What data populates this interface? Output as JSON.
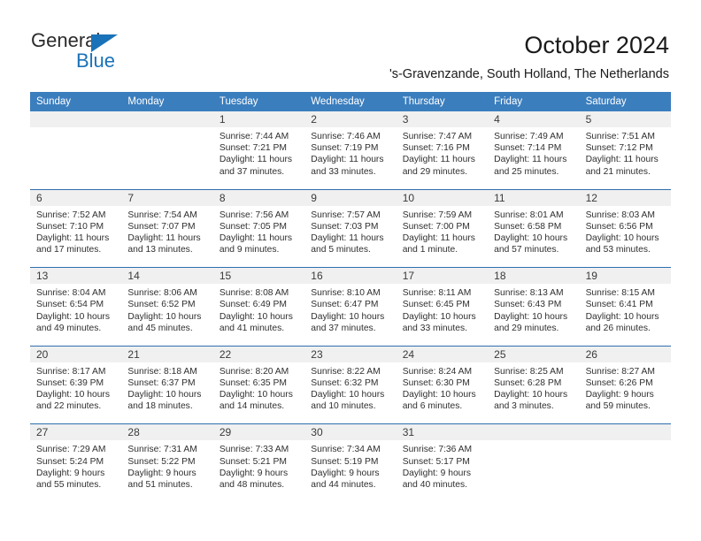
{
  "brand": {
    "name_part1": "General",
    "name_part2": "Blue",
    "accent_color": "#1a72b8"
  },
  "header": {
    "title": "October 2024",
    "subtitle": "'s-Gravenzande, South Holland, The Netherlands"
  },
  "theme": {
    "header_blue": "#3b7ebe",
    "row_divider_blue": "#2f6fae",
    "day_band_gray": "#f0f0f0"
  },
  "weekdays": [
    "Sunday",
    "Monday",
    "Tuesday",
    "Wednesday",
    "Thursday",
    "Friday",
    "Saturday"
  ],
  "weeks": [
    [
      {
        "day": "",
        "sunrise": "",
        "sunset": "",
        "daylight": ""
      },
      {
        "day": "",
        "sunrise": "",
        "sunset": "",
        "daylight": ""
      },
      {
        "day": "1",
        "sunrise": "Sunrise: 7:44 AM",
        "sunset": "Sunset: 7:21 PM",
        "daylight": "Daylight: 11 hours and 37 minutes."
      },
      {
        "day": "2",
        "sunrise": "Sunrise: 7:46 AM",
        "sunset": "Sunset: 7:19 PM",
        "daylight": "Daylight: 11 hours and 33 minutes."
      },
      {
        "day": "3",
        "sunrise": "Sunrise: 7:47 AM",
        "sunset": "Sunset: 7:16 PM",
        "daylight": "Daylight: 11 hours and 29 minutes."
      },
      {
        "day": "4",
        "sunrise": "Sunrise: 7:49 AM",
        "sunset": "Sunset: 7:14 PM",
        "daylight": "Daylight: 11 hours and 25 minutes."
      },
      {
        "day": "5",
        "sunrise": "Sunrise: 7:51 AM",
        "sunset": "Sunset: 7:12 PM",
        "daylight": "Daylight: 11 hours and 21 minutes."
      }
    ],
    [
      {
        "day": "6",
        "sunrise": "Sunrise: 7:52 AM",
        "sunset": "Sunset: 7:10 PM",
        "daylight": "Daylight: 11 hours and 17 minutes."
      },
      {
        "day": "7",
        "sunrise": "Sunrise: 7:54 AM",
        "sunset": "Sunset: 7:07 PM",
        "daylight": "Daylight: 11 hours and 13 minutes."
      },
      {
        "day": "8",
        "sunrise": "Sunrise: 7:56 AM",
        "sunset": "Sunset: 7:05 PM",
        "daylight": "Daylight: 11 hours and 9 minutes."
      },
      {
        "day": "9",
        "sunrise": "Sunrise: 7:57 AM",
        "sunset": "Sunset: 7:03 PM",
        "daylight": "Daylight: 11 hours and 5 minutes."
      },
      {
        "day": "10",
        "sunrise": "Sunrise: 7:59 AM",
        "sunset": "Sunset: 7:00 PM",
        "daylight": "Daylight: 11 hours and 1 minute."
      },
      {
        "day": "11",
        "sunrise": "Sunrise: 8:01 AM",
        "sunset": "Sunset: 6:58 PM",
        "daylight": "Daylight: 10 hours and 57 minutes."
      },
      {
        "day": "12",
        "sunrise": "Sunrise: 8:03 AM",
        "sunset": "Sunset: 6:56 PM",
        "daylight": "Daylight: 10 hours and 53 minutes."
      }
    ],
    [
      {
        "day": "13",
        "sunrise": "Sunrise: 8:04 AM",
        "sunset": "Sunset: 6:54 PM",
        "daylight": "Daylight: 10 hours and 49 minutes."
      },
      {
        "day": "14",
        "sunrise": "Sunrise: 8:06 AM",
        "sunset": "Sunset: 6:52 PM",
        "daylight": "Daylight: 10 hours and 45 minutes."
      },
      {
        "day": "15",
        "sunrise": "Sunrise: 8:08 AM",
        "sunset": "Sunset: 6:49 PM",
        "daylight": "Daylight: 10 hours and 41 minutes."
      },
      {
        "day": "16",
        "sunrise": "Sunrise: 8:10 AM",
        "sunset": "Sunset: 6:47 PM",
        "daylight": "Daylight: 10 hours and 37 minutes."
      },
      {
        "day": "17",
        "sunrise": "Sunrise: 8:11 AM",
        "sunset": "Sunset: 6:45 PM",
        "daylight": "Daylight: 10 hours and 33 minutes."
      },
      {
        "day": "18",
        "sunrise": "Sunrise: 8:13 AM",
        "sunset": "Sunset: 6:43 PM",
        "daylight": "Daylight: 10 hours and 29 minutes."
      },
      {
        "day": "19",
        "sunrise": "Sunrise: 8:15 AM",
        "sunset": "Sunset: 6:41 PM",
        "daylight": "Daylight: 10 hours and 26 minutes."
      }
    ],
    [
      {
        "day": "20",
        "sunrise": "Sunrise: 8:17 AM",
        "sunset": "Sunset: 6:39 PM",
        "daylight": "Daylight: 10 hours and 22 minutes."
      },
      {
        "day": "21",
        "sunrise": "Sunrise: 8:18 AM",
        "sunset": "Sunset: 6:37 PM",
        "daylight": "Daylight: 10 hours and 18 minutes."
      },
      {
        "day": "22",
        "sunrise": "Sunrise: 8:20 AM",
        "sunset": "Sunset: 6:35 PM",
        "daylight": "Daylight: 10 hours and 14 minutes."
      },
      {
        "day": "23",
        "sunrise": "Sunrise: 8:22 AM",
        "sunset": "Sunset: 6:32 PM",
        "daylight": "Daylight: 10 hours and 10 minutes."
      },
      {
        "day": "24",
        "sunrise": "Sunrise: 8:24 AM",
        "sunset": "Sunset: 6:30 PM",
        "daylight": "Daylight: 10 hours and 6 minutes."
      },
      {
        "day": "25",
        "sunrise": "Sunrise: 8:25 AM",
        "sunset": "Sunset: 6:28 PM",
        "daylight": "Daylight: 10 hours and 3 minutes."
      },
      {
        "day": "26",
        "sunrise": "Sunrise: 8:27 AM",
        "sunset": "Sunset: 6:26 PM",
        "daylight": "Daylight: 9 hours and 59 minutes."
      }
    ],
    [
      {
        "day": "27",
        "sunrise": "Sunrise: 7:29 AM",
        "sunset": "Sunset: 5:24 PM",
        "daylight": "Daylight: 9 hours and 55 minutes."
      },
      {
        "day": "28",
        "sunrise": "Sunrise: 7:31 AM",
        "sunset": "Sunset: 5:22 PM",
        "daylight": "Daylight: 9 hours and 51 minutes."
      },
      {
        "day": "29",
        "sunrise": "Sunrise: 7:33 AM",
        "sunset": "Sunset: 5:21 PM",
        "daylight": "Daylight: 9 hours and 48 minutes."
      },
      {
        "day": "30",
        "sunrise": "Sunrise: 7:34 AM",
        "sunset": "Sunset: 5:19 PM",
        "daylight": "Daylight: 9 hours and 44 minutes."
      },
      {
        "day": "31",
        "sunrise": "Sunrise: 7:36 AM",
        "sunset": "Sunset: 5:17 PM",
        "daylight": "Daylight: 9 hours and 40 minutes."
      },
      {
        "day": "",
        "sunrise": "",
        "sunset": "",
        "daylight": ""
      },
      {
        "day": "",
        "sunrise": "",
        "sunset": "",
        "daylight": ""
      }
    ]
  ]
}
